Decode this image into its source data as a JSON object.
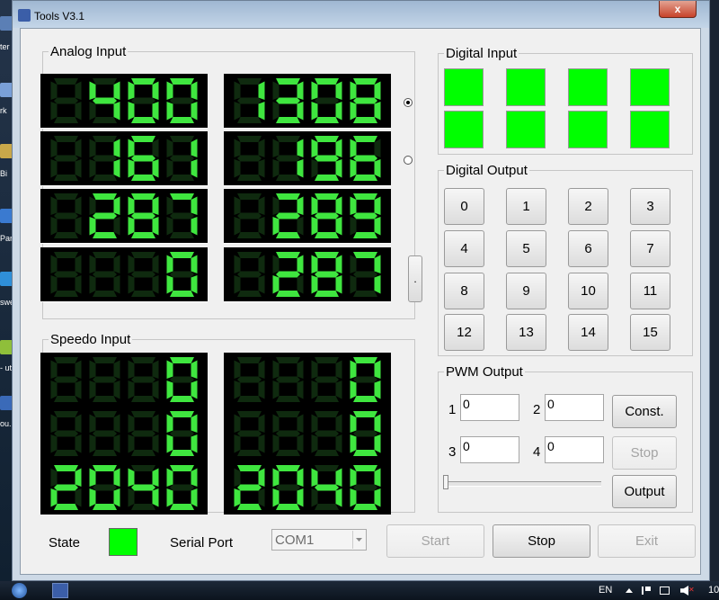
{
  "window": {
    "title": "Tools V3.1",
    "close_label": "x"
  },
  "desktop": {
    "icon_labels": [
      "ter",
      "rk",
      "Bi",
      "Par",
      "swe",
      "- ut",
      "ou. cut"
    ]
  },
  "analog": {
    "title": "Analog Input",
    "values": [
      [
        "400",
        "1308"
      ],
      [
        "161",
        "196"
      ],
      [
        "287",
        "289"
      ],
      [
        "0",
        "287"
      ]
    ],
    "side_mark": "."
  },
  "speedo": {
    "title": "Speedo Input",
    "values": [
      [
        "0",
        "0"
      ],
      [
        "0",
        "0"
      ],
      [
        "2040",
        "2040"
      ]
    ]
  },
  "digital_input": {
    "title": "Digital Input",
    "states": [
      true,
      true,
      true,
      true,
      true,
      true,
      true,
      true
    ]
  },
  "digital_output": {
    "title": "Digital Output",
    "buttons": [
      "0",
      "1",
      "2",
      "3",
      "4",
      "5",
      "6",
      "7",
      "8",
      "9",
      "10",
      "11",
      "12",
      "13",
      "14",
      "15"
    ]
  },
  "pwm": {
    "title": "PWM Output",
    "labels": [
      "1",
      "2",
      "3",
      "4"
    ],
    "values": [
      "0",
      "0",
      "0",
      "0"
    ],
    "const_label": "Const.",
    "stop_label": "Stop",
    "output_label": "Output",
    "slider_value": 0
  },
  "status": {
    "state_label": "State",
    "serial_label": "Serial Port",
    "port_value": "COM1",
    "start_label": "Start",
    "stop_label": "Stop",
    "exit_label": "Exit"
  },
  "taskbar": {
    "lang": "EN",
    "clock": "10"
  },
  "colors": {
    "seg_on": "#3fe63f",
    "seg_off": "#0f2a0f",
    "led_on": "#00ff00",
    "panel_bg": "#000000"
  }
}
